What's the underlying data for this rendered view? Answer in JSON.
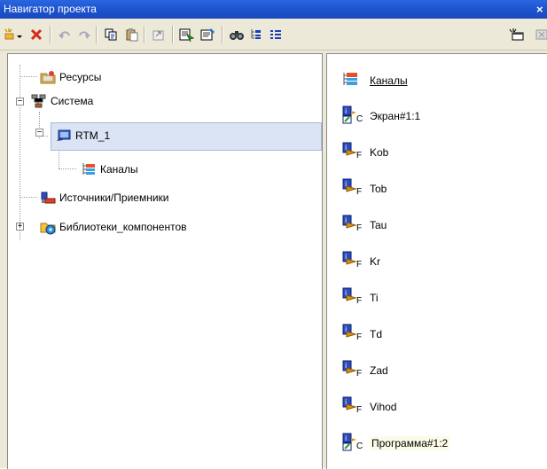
{
  "window": {
    "title": "Навигатор проекта",
    "close_glyph": "×"
  },
  "toolbar": {
    "buttons": [
      "new-item-icon",
      "delete-icon",
      "undo-icon",
      "redo-icon",
      "copy-icon",
      "paste-icon",
      "export-icon",
      "import-icon",
      "properties-icon",
      "find-icon",
      "tree-view-icon",
      "list-view-icon",
      "new-window-icon"
    ]
  },
  "tree": {
    "items": [
      {
        "label": "Ресурсы",
        "icon": "folder-resources-icon"
      },
      {
        "label": "Система",
        "icon": "system-network-icon",
        "expander": "−"
      },
      {
        "label": "RTM_1",
        "icon": "rtm-node-icon",
        "expander": "−",
        "selected": true
      },
      {
        "label": "Каналы",
        "icon": "channels-icon"
      },
      {
        "label": "Источники/Приемники",
        "icon": "sources-receivers-icon"
      },
      {
        "label": "Библиотеки_компонентов",
        "icon": "component-libraries-icon",
        "expander": "+"
      }
    ]
  },
  "list": {
    "items": [
      {
        "label": "Каналы",
        "sub": "",
        "icon": "channels-icon"
      },
      {
        "label": "Экран#1:1",
        "sub": "C",
        "icon": "screen-program-icon"
      },
      {
        "label": "Kob",
        "sub": "F",
        "icon": "function-block-icon"
      },
      {
        "label": "Tob",
        "sub": "F",
        "icon": "function-block-icon"
      },
      {
        "label": "Tau",
        "sub": "F",
        "icon": "function-block-icon"
      },
      {
        "label": "Kr",
        "sub": "F",
        "icon": "function-block-icon"
      },
      {
        "label": "Ti",
        "sub": "F",
        "icon": "function-block-icon"
      },
      {
        "label": "Td",
        "sub": "F",
        "icon": "function-block-icon"
      },
      {
        "label": "Zad",
        "sub": "F",
        "icon": "function-block-icon"
      },
      {
        "label": "Vihod",
        "sub": "F",
        "icon": "function-block-icon"
      },
      {
        "label": "Программа#1:2",
        "sub": "C",
        "icon": "screen-program-icon"
      }
    ]
  }
}
